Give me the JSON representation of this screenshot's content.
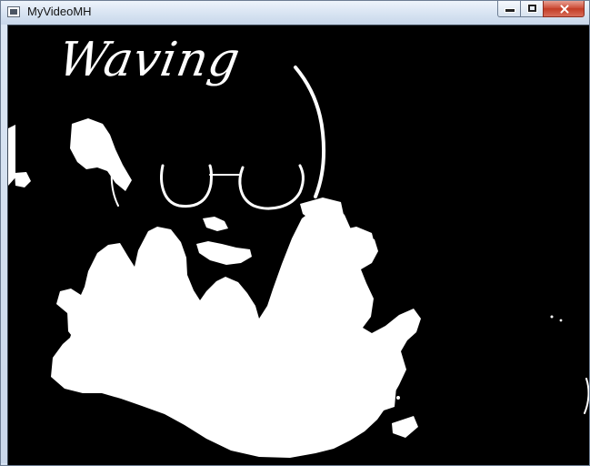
{
  "window": {
    "title": "MyVideoMH"
  },
  "window_controls": {
    "minimize_icon": "minimize-icon",
    "maximize_icon": "maximize-icon",
    "close_icon": "close-icon"
  },
  "video": {
    "gesture_label": "Waving"
  }
}
